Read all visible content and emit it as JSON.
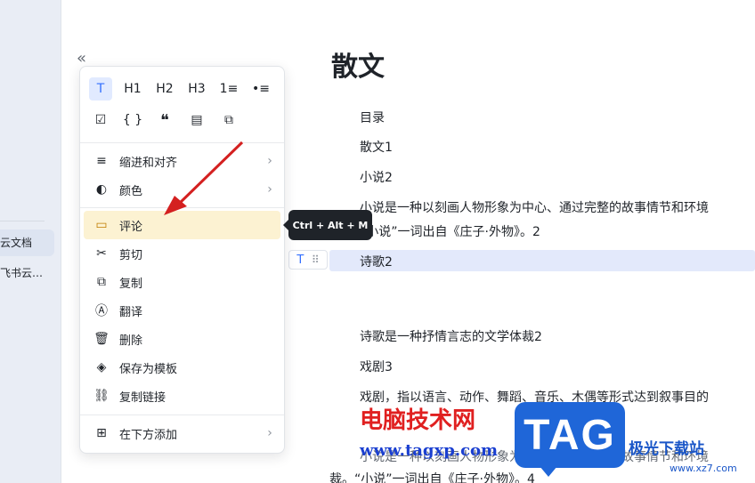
{
  "sidebar": {
    "items": [
      {
        "label": "云文档"
      },
      {
        "label": "飞书云…"
      }
    ]
  },
  "collapse_icon": "«",
  "document": {
    "title": "散文",
    "lines": [
      "目录",
      "散文1",
      "小说2",
      "小说是一种以刻画人物形象为中心、通过完整的故事情节和环境",
      "“小说”一词出自《庄子·外物》。2",
      "诗歌2",
      "诗歌是一种抒情言志的文学体裁2",
      "戏剧3",
      "戏剧，指以语言、动作、舞蹈、音乐、木偶等形式达到叙事目的",
      "小说是一种以刻画人物形象为中心、通过完整的故事情节和环境",
      "裁。“小说”一词出自《庄子·外物》。4"
    ]
  },
  "block_handle": {
    "type_icon": "T",
    "drag_icon": "⠿"
  },
  "menu": {
    "format_row1": [
      {
        "icon": "text-icon",
        "label": "T",
        "selected": true
      },
      {
        "icon": "heading1-icon",
        "label": "H1"
      },
      {
        "icon": "heading2-icon",
        "label": "H2"
      },
      {
        "icon": "heading3-icon",
        "label": "H3"
      },
      {
        "icon": "ordered-list-icon",
        "label": "1≡"
      },
      {
        "icon": "bullet-list-icon",
        "label": "•≡"
      }
    ],
    "format_row2": [
      {
        "icon": "checkbox-icon",
        "label": "☑"
      },
      {
        "icon": "code-block-icon",
        "label": "{ }"
      },
      {
        "icon": "quote-icon",
        "label": "❝"
      },
      {
        "icon": "callout-icon",
        "label": "▤"
      },
      {
        "icon": "sync-block-icon",
        "label": "⧉"
      }
    ],
    "items": [
      {
        "icon": "≡",
        "label": "缩进和对齐",
        "submenu": true
      },
      {
        "icon": "◐",
        "label": "颜色",
        "submenu": true
      },
      {
        "icon": "▭",
        "label": "评论",
        "submenu": false
      },
      {
        "icon": "✂",
        "label": "剪切",
        "submenu": false
      },
      {
        "icon": "⧉",
        "label": "复制",
        "submenu": false
      },
      {
        "icon": "Ⓐ",
        "label": "翻译",
        "submenu": false
      },
      {
        "icon": "🗑",
        "label": "删除",
        "submenu": false
      },
      {
        "icon": "◈",
        "label": "保存为模板",
        "submenu": false
      },
      {
        "icon": "⛓",
        "label": "复制链接",
        "submenu": false
      },
      {
        "icon": "⊞",
        "label": "在下方添加",
        "submenu": true
      }
    ],
    "chevron": "›"
  },
  "tooltip": "Ctrl + Alt + M",
  "watermark": {
    "red_text": "电脑技术网",
    "url": "www.tagxp.com",
    "tag": "TAG",
    "xz_logo": "极光下载站",
    "xz_url": "www.xz7.com"
  },
  "colors": {
    "accent": "#3370ff",
    "hover_bg": "#fcf2d2",
    "arrow": "#d42020"
  }
}
